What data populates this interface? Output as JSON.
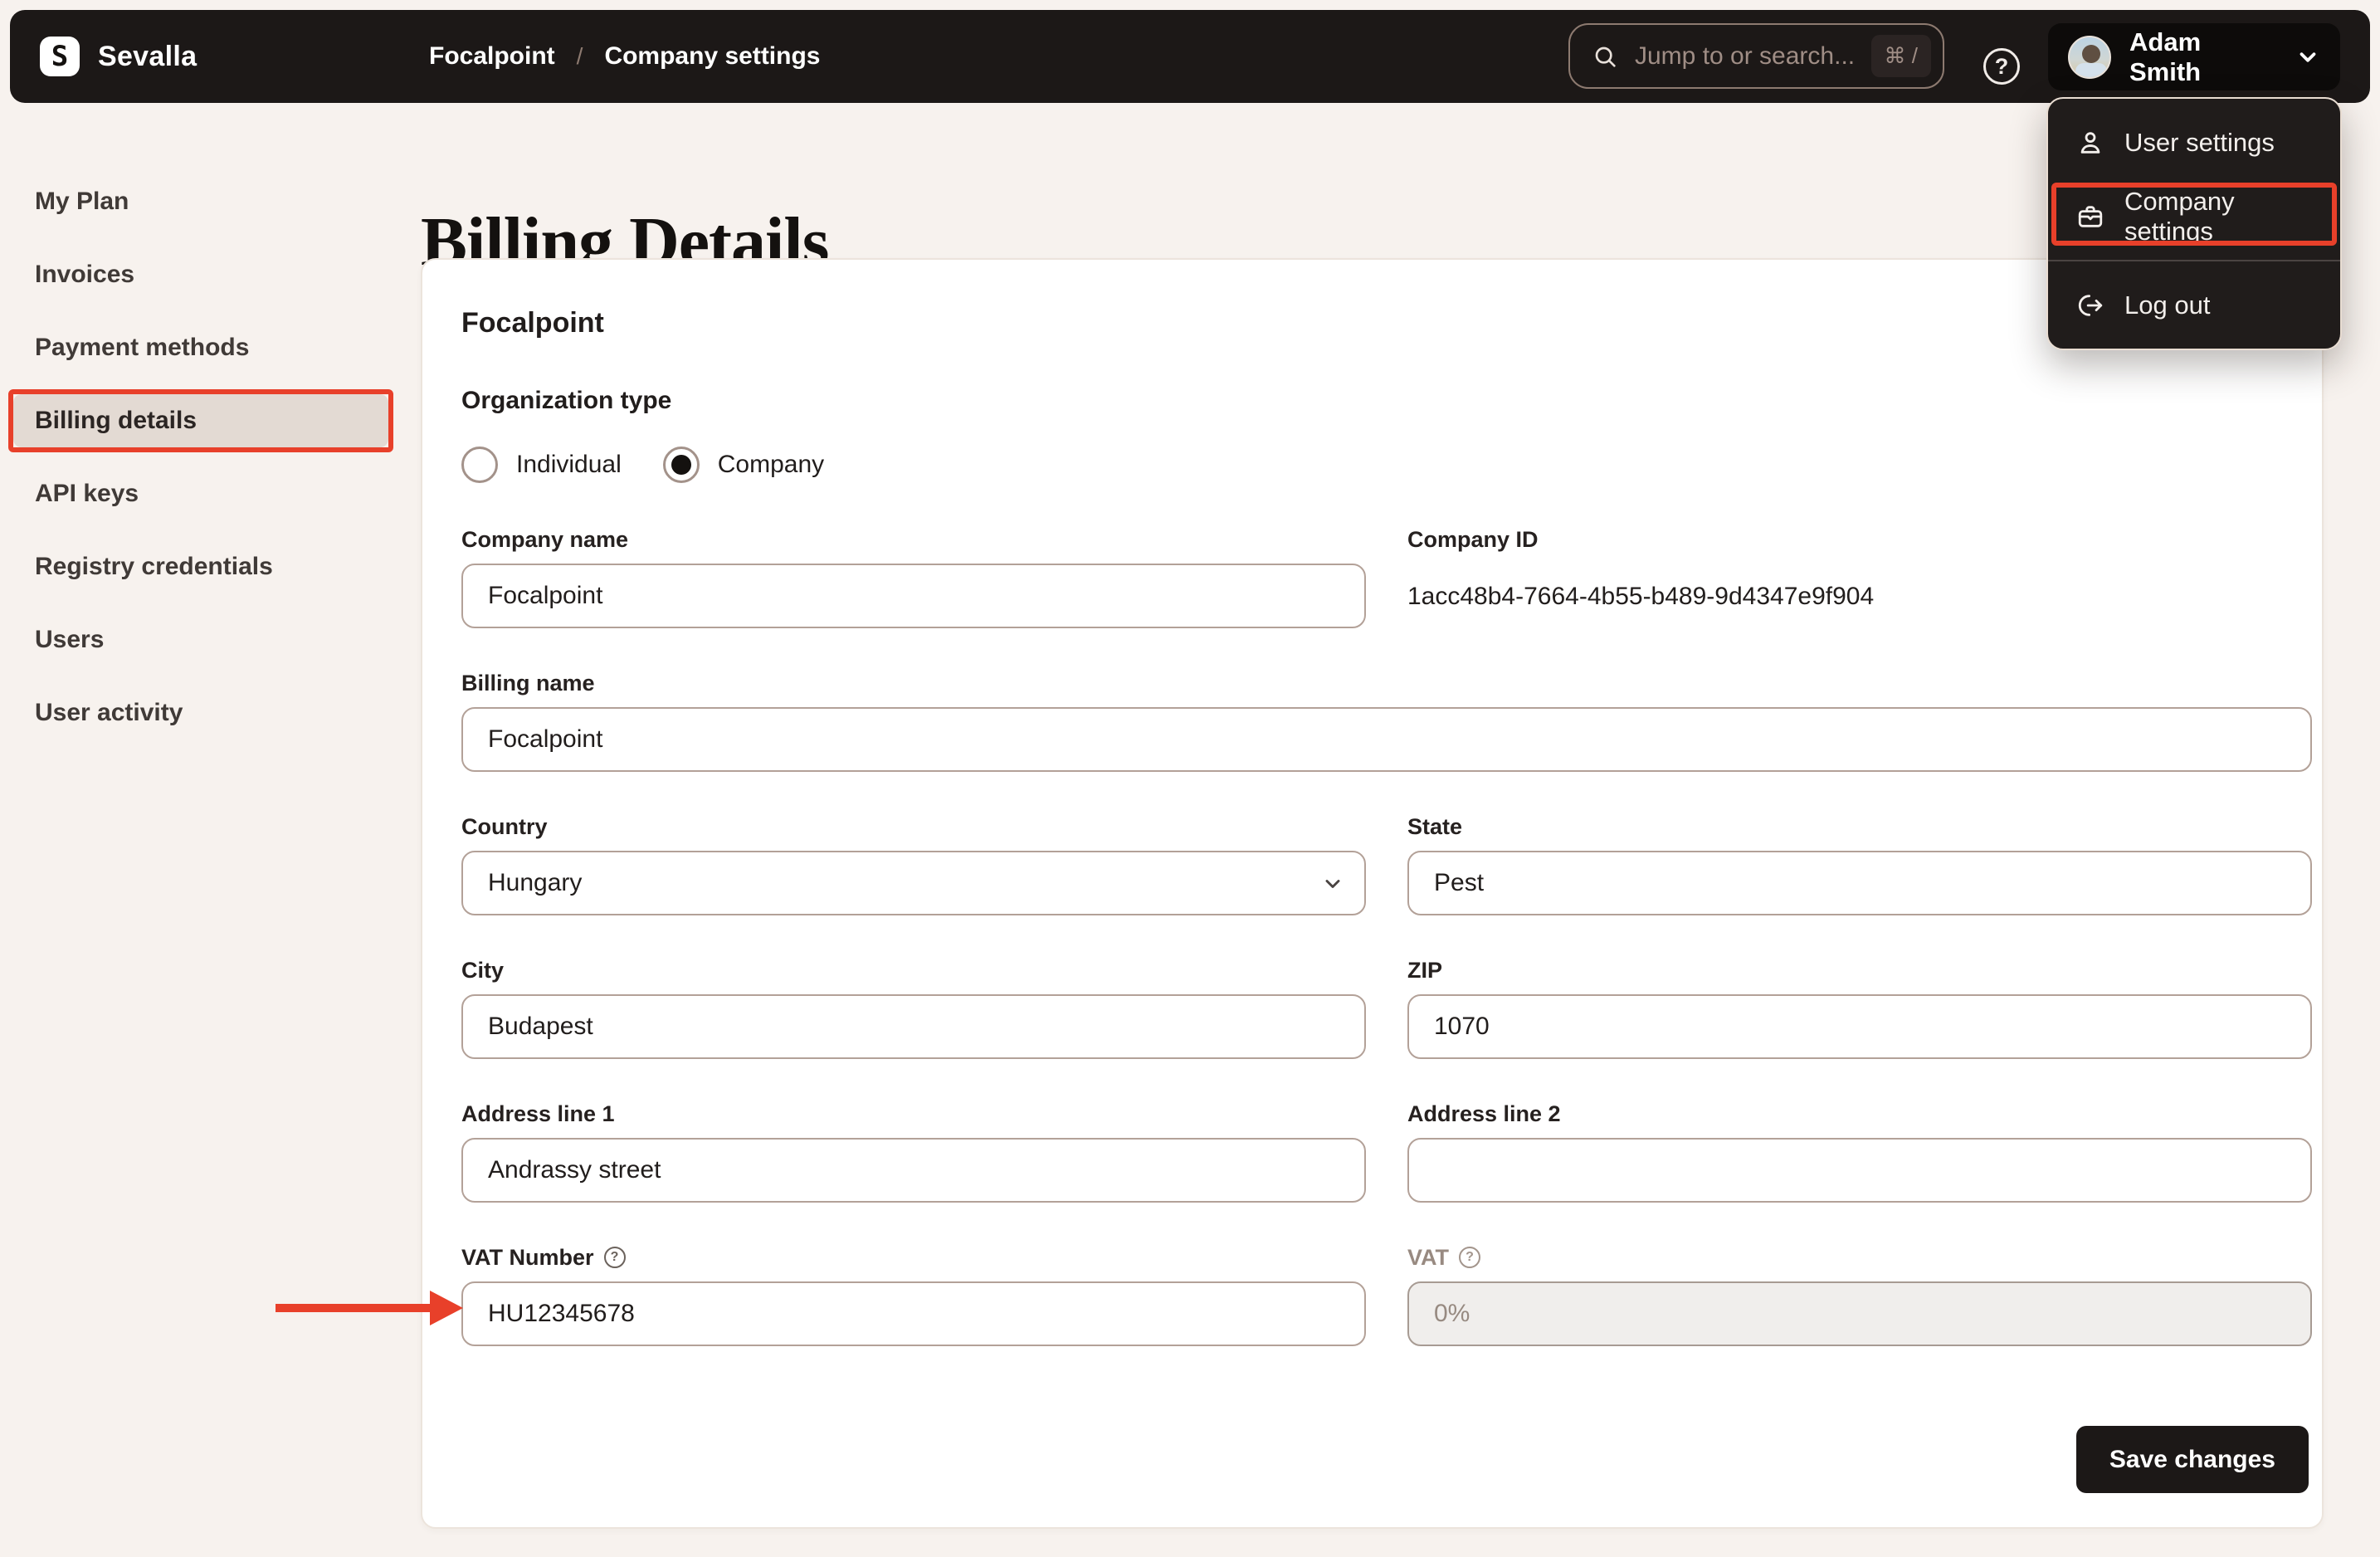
{
  "header": {
    "brand": "Sevalla",
    "logo_glyph": "S",
    "breadcrumb": {
      "items": [
        "Focalpoint",
        "Company settings"
      ],
      "separator": "/"
    },
    "search": {
      "placeholder": "Jump to or search...",
      "shortcut": "⌘ /",
      "icon": "search-icon"
    },
    "help_glyph": "?",
    "user": {
      "name": "Adam Smith",
      "icon": "chevron-down-icon"
    }
  },
  "user_menu": {
    "items": [
      {
        "label": "User settings",
        "icon": "user-icon"
      },
      {
        "label": "Company settings",
        "icon": "briefcase-icon",
        "annotated": true
      },
      {
        "label": "Log out",
        "icon": "logout-icon"
      }
    ]
  },
  "sidebar": {
    "items": [
      {
        "label": "My Plan"
      },
      {
        "label": "Invoices"
      },
      {
        "label": "Payment methods"
      },
      {
        "label": "Billing details",
        "active": true,
        "annotated": true
      },
      {
        "label": "API keys"
      },
      {
        "label": "Registry credentials"
      },
      {
        "label": "Users"
      },
      {
        "label": "User activity"
      }
    ]
  },
  "page": {
    "title": "Billing Details"
  },
  "form": {
    "company_title": "Focalpoint",
    "organization_type": {
      "label": "Organization type",
      "options": [
        {
          "label": "Individual",
          "selected": false
        },
        {
          "label": "Company",
          "selected": true
        }
      ]
    },
    "fields": {
      "company_name": {
        "label": "Company name",
        "value": "Focalpoint"
      },
      "company_id": {
        "label": "Company ID",
        "value": "1acc48b4-7664-4b55-b489-9d4347e9f904"
      },
      "billing_name": {
        "label": "Billing name",
        "value": "Focalpoint"
      },
      "country": {
        "label": "Country",
        "value": "Hungary"
      },
      "state": {
        "label": "State",
        "value": "Pest"
      },
      "city": {
        "label": "City",
        "value": "Budapest"
      },
      "zip": {
        "label": "ZIP",
        "value": "1070"
      },
      "address1": {
        "label": "Address line 1",
        "value": "Andrassy street"
      },
      "address2": {
        "label": "Address line 2",
        "value": ""
      },
      "vat_number": {
        "label": "VAT Number",
        "value": "HU12345678"
      },
      "vat": {
        "label": "VAT",
        "value": "0%",
        "disabled": true
      }
    },
    "save_label": "Save changes"
  },
  "colors": {
    "page_bg": "#f7f2ee",
    "topbar_bg": "#1c1817",
    "card_bg": "#ffffff",
    "active_item_bg": "#e3dad3",
    "input_border": "#b3a198",
    "annotation_red": "#e8402a",
    "save_button_bg": "#1c1817"
  }
}
